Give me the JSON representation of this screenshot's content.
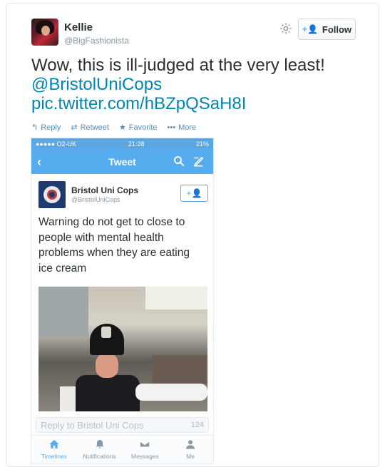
{
  "author": {
    "name": "Kellie",
    "handle": "@BigFashionista",
    "avatar_icon": "user-avatar"
  },
  "follow_button": {
    "label": "Follow",
    "icon": "follow-plus-icon"
  },
  "tweet": {
    "text": "Wow, this is ill-judged at the very least!",
    "mention": "@BristolUniCops",
    "pic_link": "pic.twitter.com/hBZpQSaH8I"
  },
  "actions": {
    "reply": "Reply",
    "retweet": "Retweet",
    "favorite": "Favorite",
    "more": "More"
  },
  "embedded": {
    "status_bar": {
      "carrier": "●●●●● O2-UK",
      "time": "21:28",
      "battery": "21%"
    },
    "nav_title": "Tweet",
    "user": {
      "name": "Bristol Uni Cops",
      "handle": "@BristolUniCops"
    },
    "text": "Warning do not get to close to people with mental health problems when they are eating ice cream",
    "reply_placeholder": "Reply to Bristol Uni Cops",
    "char_count": "124",
    "tabs": [
      {
        "label": "Timelines",
        "icon": "home-icon"
      },
      {
        "label": "Notifications",
        "icon": "bell-icon"
      },
      {
        "label": "Messages",
        "icon": "envelope-icon"
      },
      {
        "label": "Me",
        "icon": "person-icon"
      }
    ]
  },
  "colors": {
    "link": "#0084b4",
    "twitter_blue": "#55acee",
    "action_text": "#5b8bb1",
    "muted": "#8899a6"
  }
}
